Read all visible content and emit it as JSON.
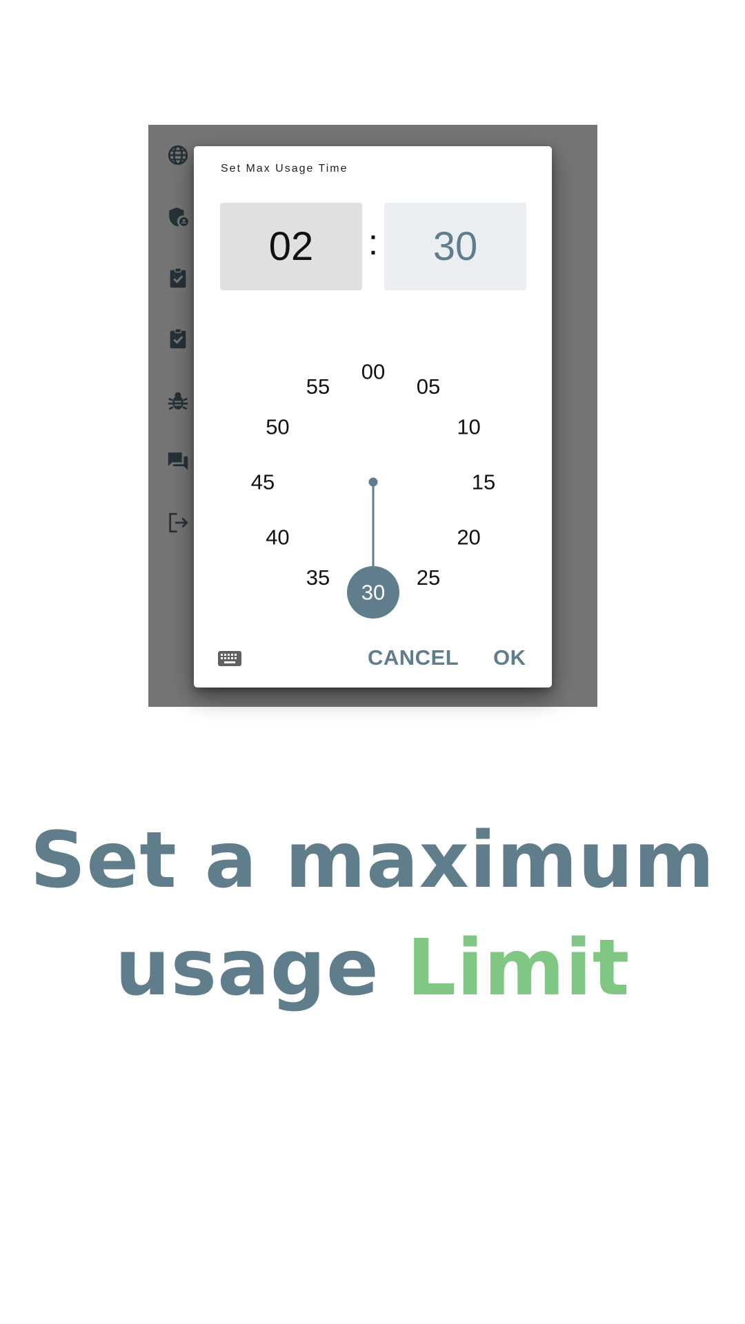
{
  "sidebar": {
    "icons": [
      "globe-icon",
      "shield-account-icon",
      "clipboard-check-icon",
      "clipboard-check-icon",
      "bug-icon",
      "forum-icon",
      "logout-icon"
    ],
    "icon_color": "#263238"
  },
  "dialog": {
    "title": "Set Max Usage Time",
    "hours": "02",
    "separator": ":",
    "minutes": "30",
    "clock_labels": [
      "00",
      "05",
      "10",
      "15",
      "20",
      "25",
      "30",
      "35",
      "40",
      "45",
      "50",
      "55"
    ],
    "selected_minute": "30",
    "keyboard_icon": "keyboard-icon",
    "cancel_label": "CANCEL",
    "ok_label": "OK",
    "accent_color": "#607d8b"
  },
  "headline": {
    "line1": "Set a maximum",
    "line2_main": "usage",
    "line2_accent": "Limit",
    "main_color": "#607d8b",
    "accent_color": "#81c784"
  }
}
